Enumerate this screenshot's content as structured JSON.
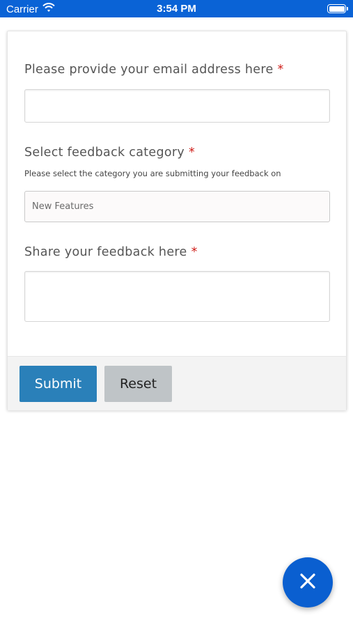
{
  "status_bar": {
    "carrier": "Carrier",
    "time": "3:54 PM",
    "wifi_icon": "wifi-icon",
    "battery_icon": "battery-icon"
  },
  "form": {
    "email": {
      "label": "Please provide your email address here",
      "required_mark": "*",
      "value": ""
    },
    "category": {
      "label": "Select feedback category",
      "required_mark": "*",
      "hint": "Please select the category you are submitting your feedback on",
      "selected": "New Features"
    },
    "feedback": {
      "label": "Share your feedback here",
      "required_mark": "*",
      "value": ""
    }
  },
  "footer": {
    "submit_label": "Submit",
    "reset_label": "Reset"
  },
  "fab": {
    "icon": "close-icon"
  },
  "colors": {
    "status_bar": "#0a63d6",
    "submit": "#2a80b9",
    "reset": "#bfc4c7",
    "required": "#d0201b",
    "fab": "#0a5fd0"
  }
}
